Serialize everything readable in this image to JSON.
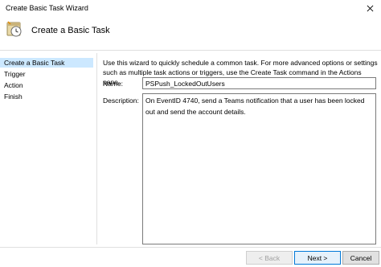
{
  "window": {
    "title": "Create Basic Task Wizard",
    "icons": {
      "close": "close-icon",
      "header": "task-scheduler-clock-icon"
    }
  },
  "header": {
    "title": "Create a Basic Task"
  },
  "nav": {
    "items": [
      {
        "label": "Create a Basic Task",
        "active": true
      },
      {
        "label": "Trigger",
        "active": false
      },
      {
        "label": "Action",
        "active": false
      },
      {
        "label": "Finish",
        "active": false
      }
    ]
  },
  "main": {
    "intro_line1": "Use this wizard to quickly schedule a common task.  For more advanced options or settings",
    "intro_line2": "such as multiple task actions or triggers, use the Create Task command in the Actions pane.",
    "name_label": "Name:",
    "name_value": "PSPush_LockedOutUsers",
    "description_label": "Description:",
    "description_value": "On EventID 4740, send a Teams notification that a user has been locked out and send the account details."
  },
  "buttons": {
    "back": "< Back",
    "next": "Next >",
    "cancel": "Cancel"
  },
  "colors": {
    "selected_nav": "#cce8ff",
    "primary_border": "#0078d7"
  }
}
